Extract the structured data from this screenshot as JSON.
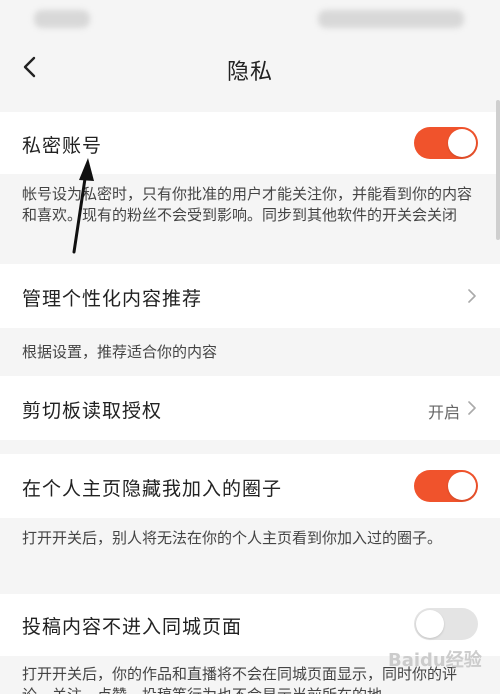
{
  "nav": {
    "title": "隐私"
  },
  "private_account": {
    "label": "私密账号",
    "toggle": "on",
    "desc": "帐号设为私密时，只有你批准的用户才能关注你，并能看到你的内容和喜欢。现有的粉丝不会受到影响。同步到其他软件的开关会关闭"
  },
  "personalized": {
    "label": "管理个性化内容推荐",
    "desc": "根据设置，推荐适合你的内容"
  },
  "clipboard": {
    "label": "剪切板读取授权",
    "value": "开启"
  },
  "hide_circles": {
    "label": "在个人主页隐藏我加入的圈子",
    "toggle": "on",
    "desc": "打开开关后，别人将无法在你的个人主页看到你加入过的圈子。"
  },
  "local_page": {
    "label": "投稿内容不进入同城页面",
    "toggle": "off",
    "desc": "打开开关后，你的作品和直播将不会在同城页面显示，同时你的评论、关注、点赞、投稿等行为也不会显示当前所在的地"
  },
  "watermark": "Baidu经验",
  "colors": {
    "accent": "#f0532c",
    "background": "#f5f5f5",
    "row": "#ffffff"
  },
  "icons": {
    "back": "chevron-left-icon",
    "arrow": "chevron-right-icon"
  }
}
